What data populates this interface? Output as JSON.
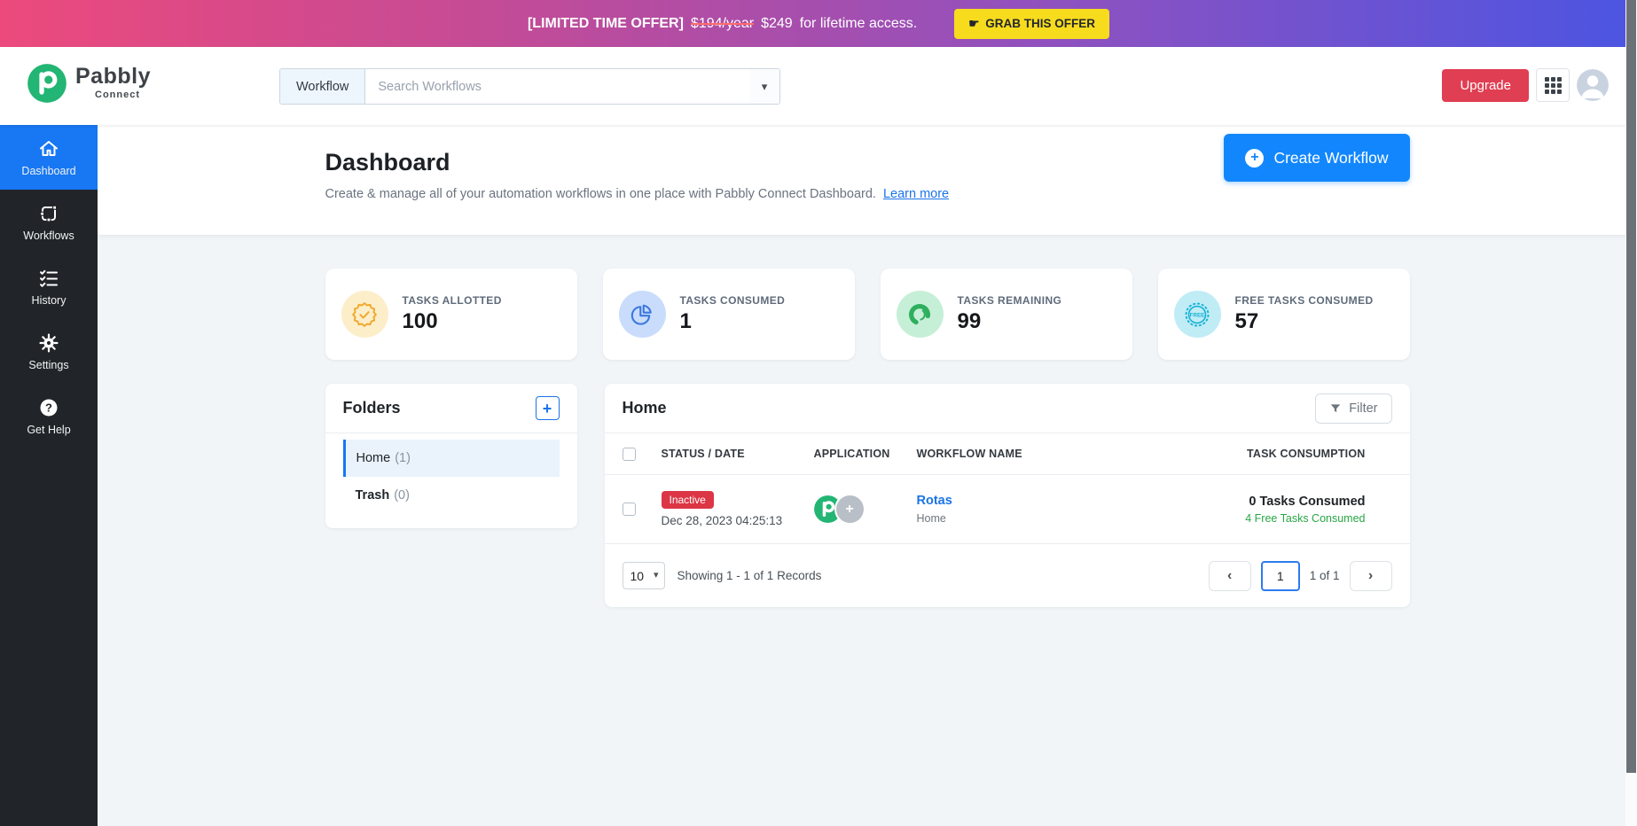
{
  "banner": {
    "offer_prefix": "[LIMITED TIME OFFER]",
    "old_price": "$194/year",
    "new_price": "$249",
    "offer_suffix": "for lifetime access.",
    "cta": "GRAB THIS OFFER"
  },
  "icons": {
    "pointer": "☛",
    "caret_down": "▾",
    "plus": "+",
    "chevron_left": "‹",
    "chevron_right": "›"
  },
  "header": {
    "logo_title": "Pabbly",
    "logo_subtitle": "Connect",
    "search_scope": "Workflow",
    "search_placeholder": "Search Workflows",
    "upgrade_label": "Upgrade"
  },
  "sidebar": {
    "items": [
      {
        "label": "Dashboard",
        "active": true
      },
      {
        "label": "Workflows",
        "active": false
      },
      {
        "label": "History",
        "active": false
      },
      {
        "label": "Settings",
        "active": false
      },
      {
        "label": "Get Help",
        "active": false
      }
    ]
  },
  "page": {
    "title": "Dashboard",
    "subtitle": "Create & manage all of your automation workflows in one place with Pabbly Connect Dashboard.",
    "learn_more": "Learn more",
    "create_workflow": "Create Workflow"
  },
  "stats": [
    {
      "label": "TASKS ALLOTTED",
      "value": "100",
      "icon": "badge-check-icon",
      "icon_color": "#f0a92e",
      "icon_bg": "#fdeeca"
    },
    {
      "label": "TASKS CONSUMED",
      "value": "1",
      "icon": "pie-chart-icon",
      "icon_color": "#3c78dd",
      "icon_bg": "#c9dcfc"
    },
    {
      "label": "TASKS REMAINING",
      "value": "99",
      "icon": "donut-chart-icon",
      "icon_color": "#2eaf5e",
      "icon_bg": "#c6efd7"
    },
    {
      "label": "FREE TASKS CONSUMED",
      "value": "57",
      "icon": "free-stamp-icon",
      "icon_color": "#17b2d4",
      "icon_bg": "#c0ecf6"
    }
  ],
  "folders": {
    "title": "Folders",
    "items": [
      {
        "name": "Home",
        "count": "(1)",
        "active": true
      },
      {
        "name": "Trash",
        "count": "(0)",
        "active": false
      }
    ]
  },
  "workflows_table": {
    "title": "Home",
    "filter_label": "Filter",
    "columns": [
      "STATUS / DATE",
      "APPLICATION",
      "WORKFLOW NAME",
      "TASK CONSUMPTION"
    ],
    "rows": [
      {
        "status": "Inactive",
        "date": "Dec 28, 2023 04:25:13",
        "name": "Rotas",
        "folder": "Home",
        "tasks_consumed": "0 Tasks Consumed",
        "free_tasks_consumed": "4 Free Tasks Consumed"
      }
    ],
    "pagination": {
      "page_size": "10",
      "summary": "Showing 1 - 1 of 1 Records",
      "current_page": "1",
      "page_info": "1 of 1"
    }
  },
  "colors": {
    "accent_blue": "#1877f2",
    "button_blue": "#1287fd",
    "upgrade_red": "#e03e52",
    "inactive_red": "#dc3545",
    "success_green": "#28a745",
    "cta_yellow": "#f7dc1e",
    "banner_gradient_left": "#ec4a7c",
    "banner_gradient_right": "#4b55e2",
    "sidebar_dark": "#212529"
  }
}
